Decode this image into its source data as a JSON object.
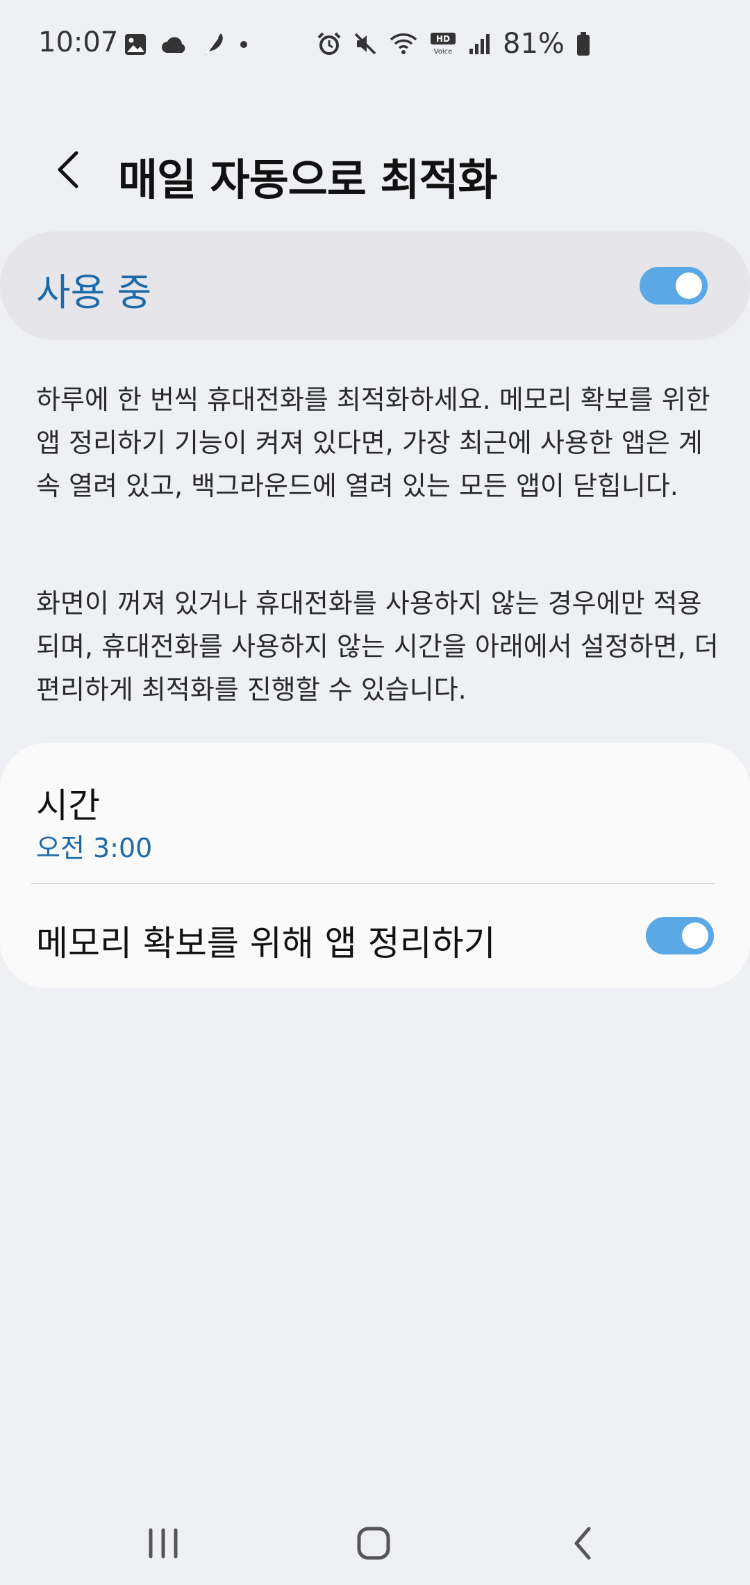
{
  "status_bar": {
    "time": "10:07",
    "battery_percent": "81%",
    "icons_left": [
      "image-icon",
      "cloud-icon",
      "feather-icon",
      "dot-icon"
    ],
    "icons_right": [
      "alarm-icon",
      "mute-icon",
      "wifi-icon",
      "hd-voice-icon",
      "signal-icon",
      "battery-icon"
    ]
  },
  "header": {
    "title": "매일 자동으로 최적화"
  },
  "master_switch": {
    "label": "사용 중",
    "on": true
  },
  "description": {
    "paragraph1": "하루에 한 번씩 휴대전화를 최적화하세요. 메모리 확보를 위한 앱 정리하기 기능이 켜져 있다면, 가장 최근에 사용한 앱은 계속 열려 있고, 백그라운드에 열려 있는 모든 앱이 닫힙니다.",
    "paragraph2": "화면이 꺼져 있거나 휴대전화를 사용하지 않는 경우에만 적용되며, 휴대전화를 사용하지 않는 시간을 아래에서 설정하면, 더 편리하게 최적화를 진행할 수 있습니다."
  },
  "settings": {
    "time_title": "시간",
    "time_value": "오전 3:00",
    "memory_label": "메모리 확보를 위해 앱 정리하기",
    "memory_on": true
  },
  "colors": {
    "accent": "#1d6aaa",
    "toggle_on": "#5aa8e6",
    "background": "#eef0f4",
    "card": "#fafafa",
    "master_card": "#e6e6ea"
  },
  "nav_bar": {
    "icons": [
      "recents-icon",
      "home-icon",
      "back-icon"
    ]
  }
}
